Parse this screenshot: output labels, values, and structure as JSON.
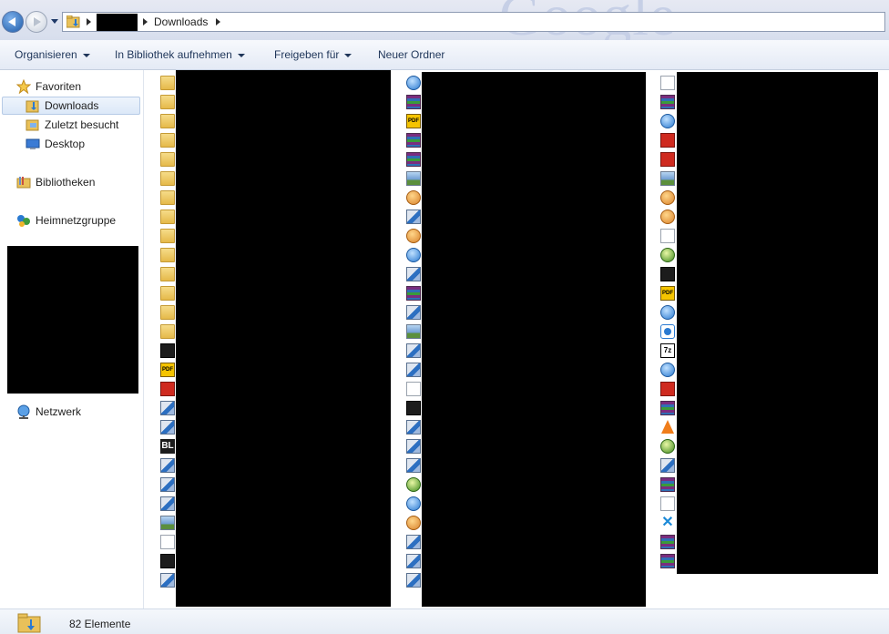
{
  "address_bar": {
    "path": [
      "Downloads"
    ],
    "background_text": "Google"
  },
  "toolbar": {
    "organise": "Organisieren",
    "add_to_library": "In Bibliothek aufnehmen",
    "share_with": "Freigeben für",
    "new_folder": "Neuer Ordner"
  },
  "nav": {
    "favorites": "Favoriten",
    "downloads": "Downloads",
    "recent": "Zuletzt besucht",
    "desktop": "Desktop",
    "libraries": "Bibliotheken",
    "homegroup": "Heimnetzgruppe",
    "network": "Netzwerk"
  },
  "content": {
    "columns": [
      [
        "folder",
        "folder",
        "folder",
        "folder",
        "folder",
        "folder",
        "folder",
        "folder",
        "folder",
        "folder",
        "folder",
        "folder",
        "folder",
        "folder",
        "amd-icon",
        "pdf-icon",
        "acrobat-icon",
        "setup-icon",
        "installer-icon",
        "bl-icon",
        "java-icon",
        "setup-disc-icon",
        "installer-icon",
        "image-icon",
        "document-icon",
        "xbox-icon",
        "setup-icon"
      ],
      [
        "network-icon",
        "rar-icon",
        "pdf-icon",
        "rar-icon",
        "rar-icon",
        "image-icon",
        "download-icon",
        "setup-icon",
        "firefox-icon",
        "chrome-icon",
        "setup-disc-icon",
        "rar-icon",
        "setup-icon",
        "image-icon",
        "setup-icon",
        "setup-icon",
        "document-icon",
        "league-icon",
        "setup-icon",
        "setup-icon",
        "installer-icon",
        "green-icon",
        "network-icon",
        "origin-icon",
        "setup-icon",
        "setup-icon",
        "setup-icon"
      ],
      [
        "uninstall-icon",
        "rar-icon",
        "network-icon",
        "media-icon",
        "filezilla-icon",
        "window-icon",
        "package-icon",
        "package-icon",
        "document-icon",
        "minecraft-icon",
        "steam-icon",
        "pdf-icon",
        "audio-icon",
        "teamviewer-icon",
        "7zip-icon",
        "arrow-icon",
        "red-icon",
        "rar-icon",
        "vlc-icon",
        "globe-icon",
        "printer-icon",
        "rar-icon",
        "text-icon",
        "x-icon",
        "rar-icon",
        "rar-icon"
      ]
    ]
  },
  "status": {
    "item_count": "82 Elemente"
  },
  "colors": {
    "selection": "#dce8f8",
    "toolbar_text": "#1e3559",
    "redaction": "#000000"
  }
}
